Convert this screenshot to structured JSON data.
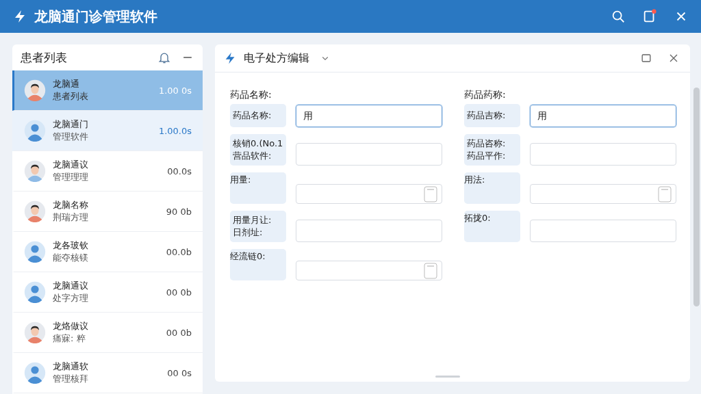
{
  "window": {
    "title": "龙脑通门诊管理软件",
    "notification_badge": true
  },
  "patient_panel": {
    "title": "患者列表",
    "patients": [
      {
        "name": "龙脑通",
        "subtitle": "患者列表",
        "time": "1.00 0s",
        "kind": "person",
        "selected": true,
        "highlighted": false
      },
      {
        "name": "龙脑通门",
        "subtitle": "管理软件",
        "time": "1.00.0s",
        "kind": "silhouette",
        "selected": false,
        "highlighted": true
      },
      {
        "name": "龙脑通议",
        "subtitle": "管理理理",
        "time": "00.0s",
        "kind": "person",
        "selected": false,
        "highlighted": false
      },
      {
        "name": "龙脑名称",
        "subtitle": "荆瑞方理",
        "time": "90 0b",
        "kind": "person",
        "selected": false,
        "highlighted": false
      },
      {
        "name": "龙各玻钦",
        "subtitle": "能夺核镁",
        "time": "00.0b",
        "kind": "silhouette",
        "selected": false,
        "highlighted": false
      },
      {
        "name": "龙脑通议",
        "subtitle": "处字方理",
        "time": "00 0b",
        "kind": "silhouette",
        "selected": false,
        "highlighted": false
      },
      {
        "name": "龙烙做议",
        "subtitle": "痛寐: 粹",
        "time": "00 0b",
        "kind": "person",
        "selected": false,
        "highlighted": false
      },
      {
        "name": "龙脑通软",
        "subtitle": "管理核拜",
        "time": "00 0s",
        "kind": "silhouette",
        "selected": false,
        "highlighted": false
      }
    ]
  },
  "editor": {
    "title": "电子处方编辑",
    "columns": [
      [
        {
          "top_label": "药品名称:",
          "label": [
            "药品名称:"
          ],
          "value": "用",
          "focused": true,
          "picker": false
        },
        {
          "label": [
            "核销0.(No.1",
            "营品软件:"
          ],
          "focused": false,
          "picker": false
        },
        {
          "label": [
            "用量:"
          ],
          "focused": false,
          "picker": true
        },
        {
          "label": [
            "用量月让:",
            "日剂址:"
          ],
          "focused": false,
          "picker": false
        },
        {
          "label": [
            "经流链0:"
          ],
          "focused": false,
          "picker": true
        }
      ],
      [
        {
          "top_label": "药品药称:",
          "label": [
            "药品吉称:"
          ],
          "value": "用",
          "focused": true,
          "picker": false
        },
        {
          "label": [
            "药品咨称:",
            "药品平作:"
          ],
          "focused": false,
          "picker": false
        },
        {
          "label": [
            "用法:"
          ],
          "focused": false,
          "picker": true
        },
        {
          "label": [
            "拓拢0:"
          ],
          "focused": false,
          "picker": false
        }
      ]
    ]
  }
}
